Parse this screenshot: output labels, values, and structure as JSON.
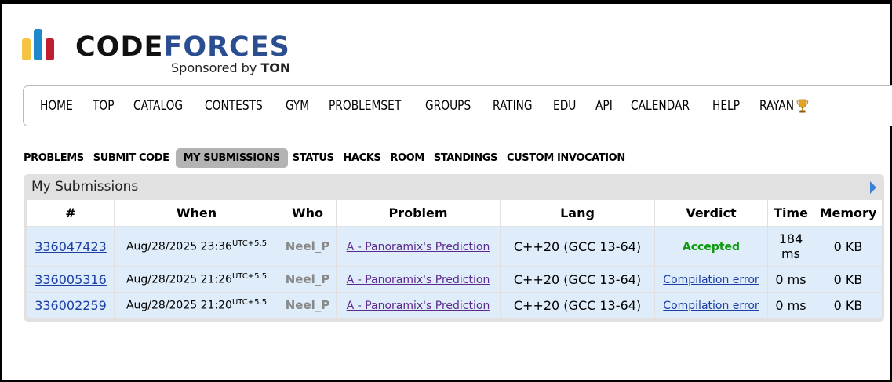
{
  "logo": {
    "word_part1": "CODE",
    "word_part2": "FORCES",
    "sponsor_prefix": "Sponsored by ",
    "sponsor_name": "TON"
  },
  "menu": {
    "items": [
      "HOME",
      "TOP",
      "CATALOG",
      "CONTESTS",
      "GYM",
      "PROBLEMSET",
      "GROUPS",
      "RATING",
      "EDU",
      "API",
      "CALENDAR",
      "HELP",
      "RAYAN"
    ]
  },
  "subnav": {
    "items": [
      "PROBLEMS",
      "SUBMIT CODE",
      "MY SUBMISSIONS",
      "STATUS",
      "HACKS",
      "ROOM",
      "STANDINGS",
      "CUSTOM INVOCATION"
    ],
    "active": "MY SUBMISSIONS"
  },
  "panel": {
    "title": "My Submissions"
  },
  "table": {
    "headers": [
      "#",
      "When",
      "Who",
      "Problem",
      "Lang",
      "Verdict",
      "Time",
      "Memory"
    ],
    "rows": [
      {
        "id": "336047423",
        "when": "Aug/28/2025 23:36",
        "tz": "UTC+5.5",
        "who": "Neel_P",
        "problem": "A - Panoramix's Prediction",
        "lang": "C++20 (GCC 13-64)",
        "verdict": "Accepted",
        "time": "184 ms",
        "memory": "0 KB"
      },
      {
        "id": "336005316",
        "when": "Aug/28/2025 21:26",
        "tz": "UTC+5.5",
        "who": "Neel_P",
        "problem": "A - Panoramix's Prediction",
        "lang": "C++20 (GCC 13-64)",
        "verdict": "Compilation error",
        "time": "0 ms",
        "memory": "0 KB"
      },
      {
        "id": "336002259",
        "when": "Aug/28/2025 21:20",
        "tz": "UTC+5.5",
        "who": "Neel_P",
        "problem": "A - Panoramix's Prediction",
        "lang": "C++20 (GCC 13-64)",
        "verdict": "Compilation error",
        "time": "0 ms",
        "memory": "0 KB"
      }
    ]
  },
  "colors": {
    "accepted": "#0a9a0a",
    "link": "#1c3fa6",
    "row_bg": "#dfedfb",
    "panel_bg": "#e1e1e1"
  }
}
